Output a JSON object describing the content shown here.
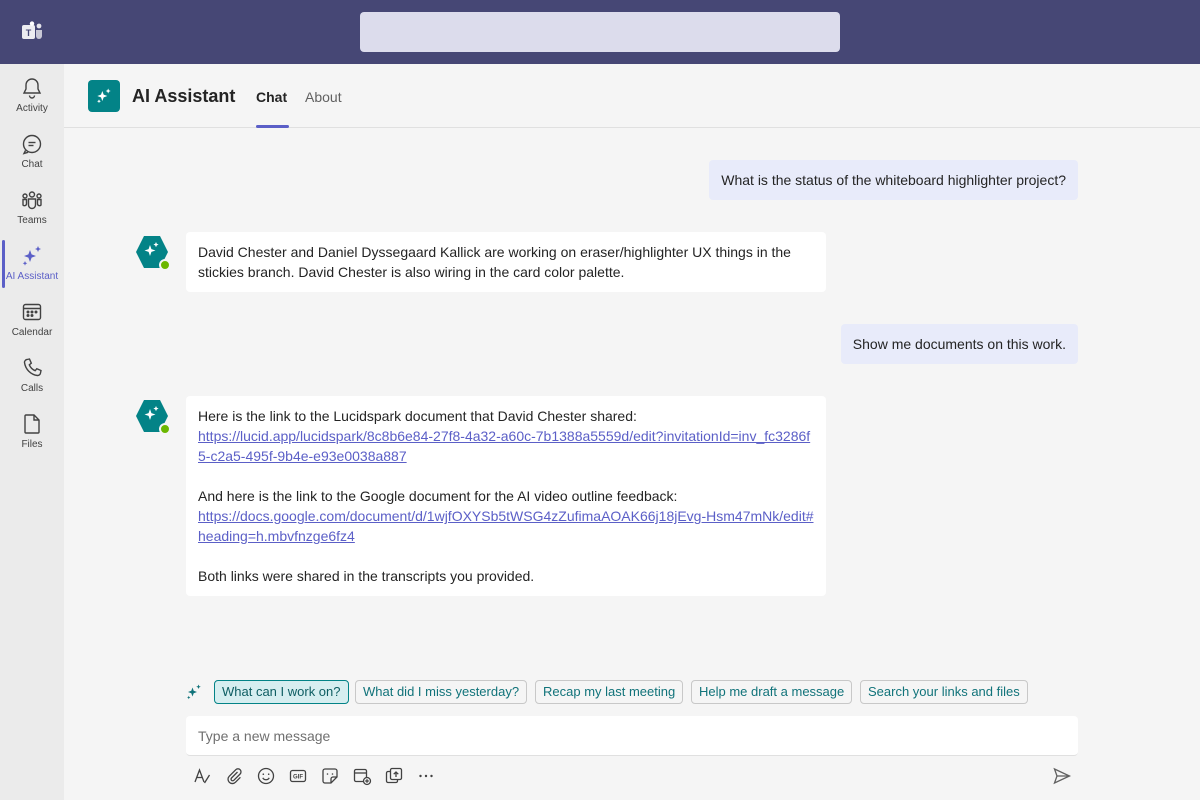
{
  "app": {
    "title": "AI Assistant",
    "accent": "#5b5fc7",
    "brand": "#464775",
    "assistant_color": "#038387"
  },
  "rail": {
    "items": [
      {
        "label": "Activity",
        "icon": "bell-icon"
      },
      {
        "label": "Chat",
        "icon": "chat-icon"
      },
      {
        "label": "Teams",
        "icon": "teams-icon"
      },
      {
        "label": "AI Assistant",
        "icon": "sparkle-icon",
        "active": true
      },
      {
        "label": "Calendar",
        "icon": "calendar-icon"
      },
      {
        "label": "Calls",
        "icon": "phone-icon"
      },
      {
        "label": "Files",
        "icon": "file-icon"
      }
    ]
  },
  "tabs": [
    {
      "label": "Chat",
      "active": true
    },
    {
      "label": "About"
    }
  ],
  "messages": {
    "user1": "What is the status of the whiteboard highlighter project?",
    "bot1": "David Chester and Daniel Dyssegaard Kallick are working on eraser/highlighter UX things in the stickies branch. David Chester is also wiring in the card color palette.",
    "user2": "Show me documents on this work.",
    "bot2": {
      "intro1": "Here is the link to the Lucidspark document that David Chester shared:",
      "link1": "https://lucid.app/lucidspark/8c8b6e84-27f8-4a32-a60c-7b1388a5559d/edit?invitationId=inv_fc3286f5-c2a5-495f-9b4e-e93e0038a887",
      "intro2": "And here is the link to the Google document for the AI video outline feedback:",
      "link2": "https://docs.google.com/document/d/1wjfOXYSb5tWSG4zZufimaAOAK66j18jEvg-Hsm47mNk/edit#heading=h.mbvfnzge6fz4",
      "outro": "Both links were shared in the transcripts you provided."
    }
  },
  "suggestions": [
    {
      "label": "What can I work on?",
      "selected": true
    },
    {
      "label": "What did I miss yesterday?"
    },
    {
      "label": "Recap my last meeting"
    },
    {
      "label": "Help me draft a message"
    },
    {
      "label": "Search your links and files"
    }
  ],
  "compose": {
    "placeholder": "Type a new message",
    "value": ""
  },
  "toolbar": {
    "icons": [
      "format-icon",
      "attach-icon",
      "emoji-icon",
      "gif-icon",
      "sticker-icon",
      "schedule-meeting-icon",
      "share-screen-icon",
      "more-icon",
      "send-icon"
    ]
  }
}
